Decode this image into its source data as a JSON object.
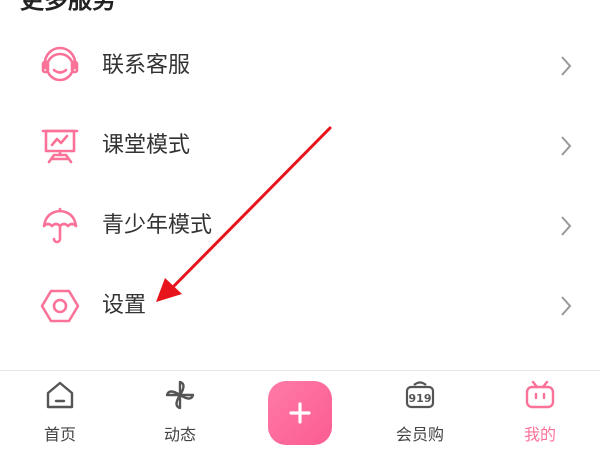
{
  "section": {
    "title": "更多服务"
  },
  "menu": {
    "items": [
      {
        "label": "联系客服",
        "icon": "headset-icon"
      },
      {
        "label": "课堂模式",
        "icon": "classroom-board-icon"
      },
      {
        "label": "青少年模式",
        "icon": "umbrella-icon"
      },
      {
        "label": "设置",
        "icon": "settings-hexagon-icon"
      }
    ]
  },
  "tabbar": {
    "tabs": [
      {
        "label": "首页",
        "icon": "home-icon"
      },
      {
        "label": "动态",
        "icon": "pinwheel-icon"
      },
      {
        "label": "",
        "icon": "plus-icon"
      },
      {
        "label": "会员购",
        "icon": "shopping-919-icon"
      },
      {
        "label": "我的",
        "icon": "tv-mascot-icon",
        "active": true
      }
    ]
  },
  "colors": {
    "accent": "#fb7299",
    "annotation_arrow": "#e8141c"
  }
}
